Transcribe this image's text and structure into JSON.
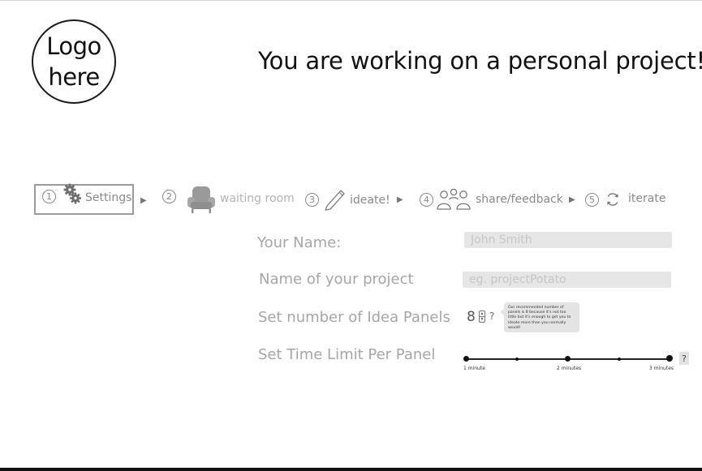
{
  "logo": {
    "line1": "Logo",
    "line2": "here"
  },
  "headline": "You are working on a personal project!",
  "steps": [
    {
      "num": "1",
      "label": "Settings",
      "icon": "gears-icon"
    },
    {
      "num": "2",
      "label": "waiting room",
      "icon": "armchair-icon"
    },
    {
      "num": "3",
      "label": "ideate!",
      "icon": "pencil-icon"
    },
    {
      "num": "4",
      "label": "share/feedback",
      "icon": "people-icon"
    },
    {
      "num": "5",
      "label": "iterate",
      "icon": "refresh-icon"
    }
  ],
  "form": {
    "name_label": "Your Name:",
    "name_placeholder": "John Smith",
    "project_label": "Name of your project",
    "project_placeholder": "eg. projectPotato",
    "panels_label": "Set number of Idea Panels",
    "panels_value": "8",
    "panels_help": "?",
    "panels_tooltip": "Our recommended number of panels is 8 because it's not too little but it's enough to get you to ideate more than you normally would!",
    "time_label": "Set Time Limit Per Panel",
    "time_ticks": [
      "1 minute",
      "2 minutes",
      "3 minutes"
    ],
    "time_help": "?"
  },
  "colors": {
    "muted_text": "#a6a6a6",
    "field_bg": "#e6e6e6",
    "step_text": "#8a8a8a"
  }
}
